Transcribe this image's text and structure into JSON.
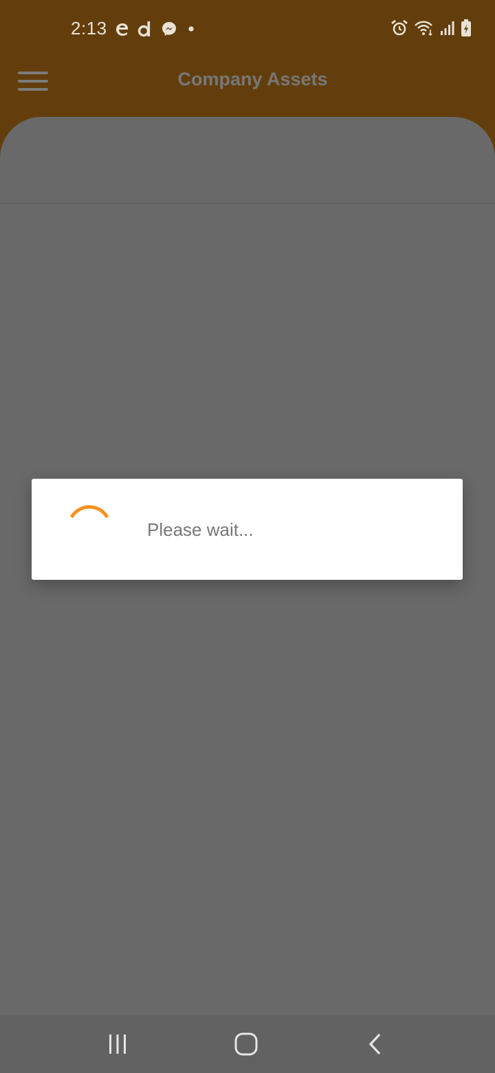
{
  "status_bar": {
    "time": "2:13",
    "left_icons": [
      "edge-icon",
      "d-app-icon",
      "messenger-icon",
      "notification-dot-icon"
    ],
    "right_icons": [
      "alarm-icon",
      "wifi-icon",
      "signal-icon",
      "battery-charging-icon"
    ]
  },
  "app_bar": {
    "title": "Company Assets",
    "background": "#633e0c"
  },
  "dialog": {
    "message": "Please wait...",
    "spinner_color": "#f5921e"
  },
  "nav_bar": {
    "buttons": [
      "recent-apps-icon",
      "home-icon",
      "back-icon"
    ]
  }
}
